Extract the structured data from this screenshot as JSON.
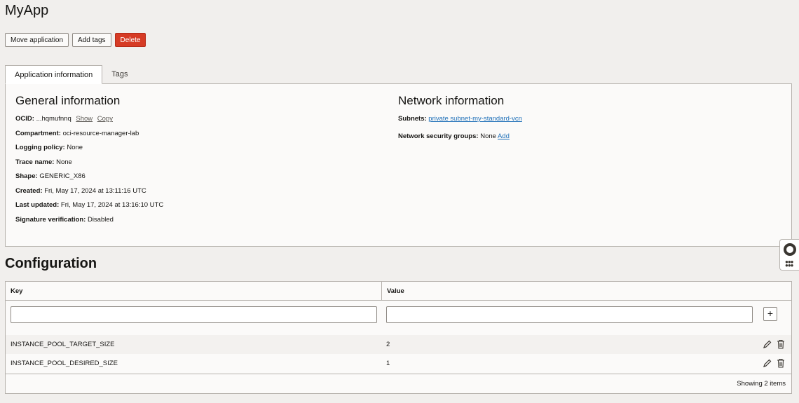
{
  "page": {
    "title": "MyApp"
  },
  "actions": {
    "move": "Move application",
    "add_tags": "Add tags",
    "delete": "Delete"
  },
  "tabs": [
    {
      "label": "Application information"
    },
    {
      "label": "Tags"
    }
  ],
  "general": {
    "title": "General information",
    "ocid_label": "OCID:",
    "ocid_value": "...hqmufnnq",
    "ocid_show": "Show",
    "ocid_copy": "Copy",
    "compartment_label": "Compartment:",
    "compartment_value": "oci-resource-manager-lab",
    "logging_label": "Logging policy:",
    "logging_value": "None",
    "trace_label": "Trace name:",
    "trace_value": "None",
    "shape_label": "Shape:",
    "shape_value": "GENERIC_X86",
    "created_label": "Created:",
    "created_value": "Fri, May 17, 2024 at 13:11:16 UTC",
    "updated_label": "Last updated:",
    "updated_value": "Fri, May 17, 2024 at 13:16:10 UTC",
    "signature_label": "Signature verification:",
    "signature_value": "Disabled"
  },
  "network": {
    "title": "Network information",
    "subnets_label": "Subnets:",
    "subnets_value": "private subnet-my-standard-vcn",
    "nsg_label": "Network security groups:",
    "nsg_value": "None",
    "nsg_add": "Add"
  },
  "configuration": {
    "title": "Configuration",
    "headers": {
      "key": "Key",
      "value": "Value"
    },
    "key_input_value": "",
    "value_input_value": "",
    "add_symbol": "+",
    "rows": [
      {
        "key": "INSTANCE_POOL_TARGET_SIZE",
        "value": "2"
      },
      {
        "key": "INSTANCE_POOL_DESIRED_SIZE",
        "value": "1"
      }
    ],
    "footer": "Showing 2 items"
  },
  "icons": {
    "help": "lifebuoy-icon",
    "grid": "grid-dots-icon",
    "edit": "pencil-icon",
    "delete": "trash-icon"
  },
  "colors": {
    "danger": "#d63b25",
    "link": "#1e6fb8",
    "background": "#f1efed"
  }
}
